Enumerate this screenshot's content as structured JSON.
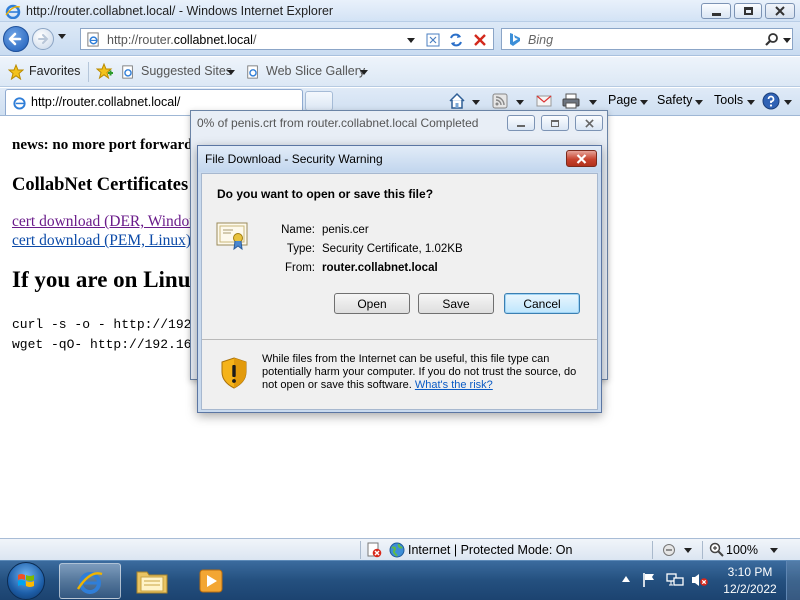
{
  "window": {
    "title": "http://router.collabnet.local/ - Windows Internet Explorer"
  },
  "navbar": {
    "address_host_prefix": "http://router.",
    "address_host_main": "collabnet.local",
    "address_host_suffix": "/",
    "search_placeholder": "Bing"
  },
  "favorites_bar": {
    "favorites_label": "Favorites",
    "items": [
      "Suggested Sites",
      "Web Slice Gallery"
    ]
  },
  "tabs": {
    "active_tab_label": "http://router.collabnet.local/"
  },
  "command_bar": {
    "page_label": "Page",
    "safety_label": "Safety",
    "tools_label": "Tools"
  },
  "content": {
    "news_line": "news: no more port forwarding",
    "cert_heading": "CollabNet Certificates",
    "link_der": "cert download (DER, Windows)",
    "link_pem": "cert download (PEM, Linux)",
    "linux_heading": "If you are on Linux",
    "code_curl": "curl -s -o - http://192.168.",
    "code_wget": "wget -qO- http://192.168."
  },
  "progress_window": {
    "title": "0% of penis.crt from router.collabnet.local Completed"
  },
  "dialog": {
    "title": "File Download - Security Warning",
    "question": "Do you want to open or save this file?",
    "name_label": "Name:",
    "name_value": "penis.cer",
    "type_label": "Type:",
    "type_value": "Security Certificate, 1.02KB",
    "from_label": "From:",
    "from_value": "router.collabnet.local",
    "open_label": "Open",
    "save_label": "Save",
    "cancel_label": "Cancel",
    "warning_text": "While files from the Internet can be useful, this file type can potentially harm your computer. If you do not trust the source, do not open or save this software.",
    "risk_link": "What's the risk?"
  },
  "statusbar": {
    "zone_text": "Internet | Protected Mode: On",
    "zoom_text": "100%"
  },
  "taskbar": {
    "time": "3:10 PM",
    "date": "12/2/2022"
  },
  "colors": {
    "accent": "#1c5cb8",
    "visited_link": "#6a1b8a",
    "link": "#0b4aa8",
    "dialog_close": "#c8442f"
  }
}
